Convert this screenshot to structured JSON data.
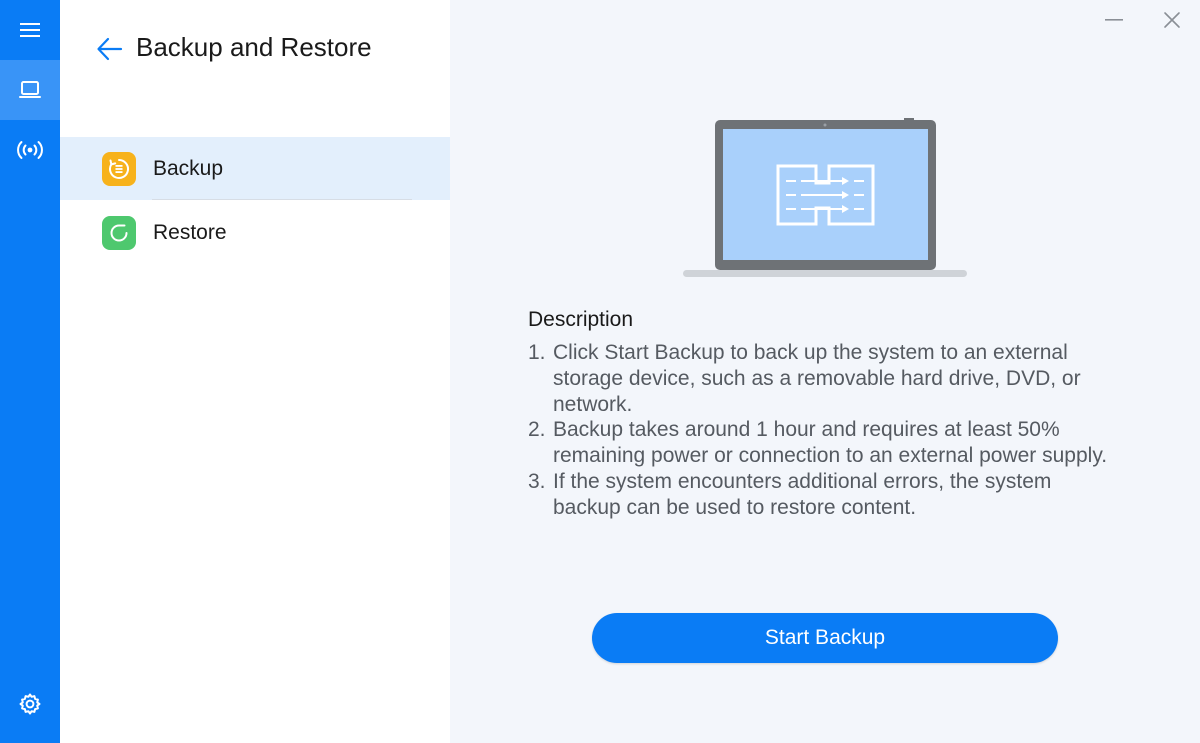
{
  "header": {
    "title": "Backup and Restore"
  },
  "rail": {
    "items": [
      {
        "name": "menu",
        "icon": "hamburger-icon"
      },
      {
        "name": "device",
        "icon": "laptop-icon",
        "active": true
      },
      {
        "name": "wireless",
        "icon": "wireless-broadcast-icon"
      },
      {
        "name": "settings",
        "icon": "gear-icon"
      }
    ]
  },
  "sidebar": {
    "items": [
      {
        "label": "Backup",
        "icon": "backup-icon",
        "icon_color": "#f7b21b",
        "selected": true
      },
      {
        "label": "Restore",
        "icon": "restore-icon",
        "icon_color": "#4ec86e",
        "selected": false
      }
    ]
  },
  "window": {
    "minimize_icon": "minimize-icon",
    "close_icon": "close-icon"
  },
  "description": {
    "title": "Description",
    "items": [
      {
        "num": "1.",
        "text": "Click Start Backup to back up the system to an external storage device, such as a removable hard drive, DVD, or network."
      },
      {
        "num": "2.",
        "text": "Backup takes around 1 hour and requires at least 50% remaining power or connection to an external power supply."
      },
      {
        "num": "3.",
        "text": "If the system encounters additional errors, the system backup can be used to restore content."
      }
    ]
  },
  "actions": {
    "start_label": "Start Backup"
  },
  "colors": {
    "accent": "#0a7cf5",
    "selected_bg": "#e3effc",
    "panel_bg": "#f3f6fb"
  }
}
